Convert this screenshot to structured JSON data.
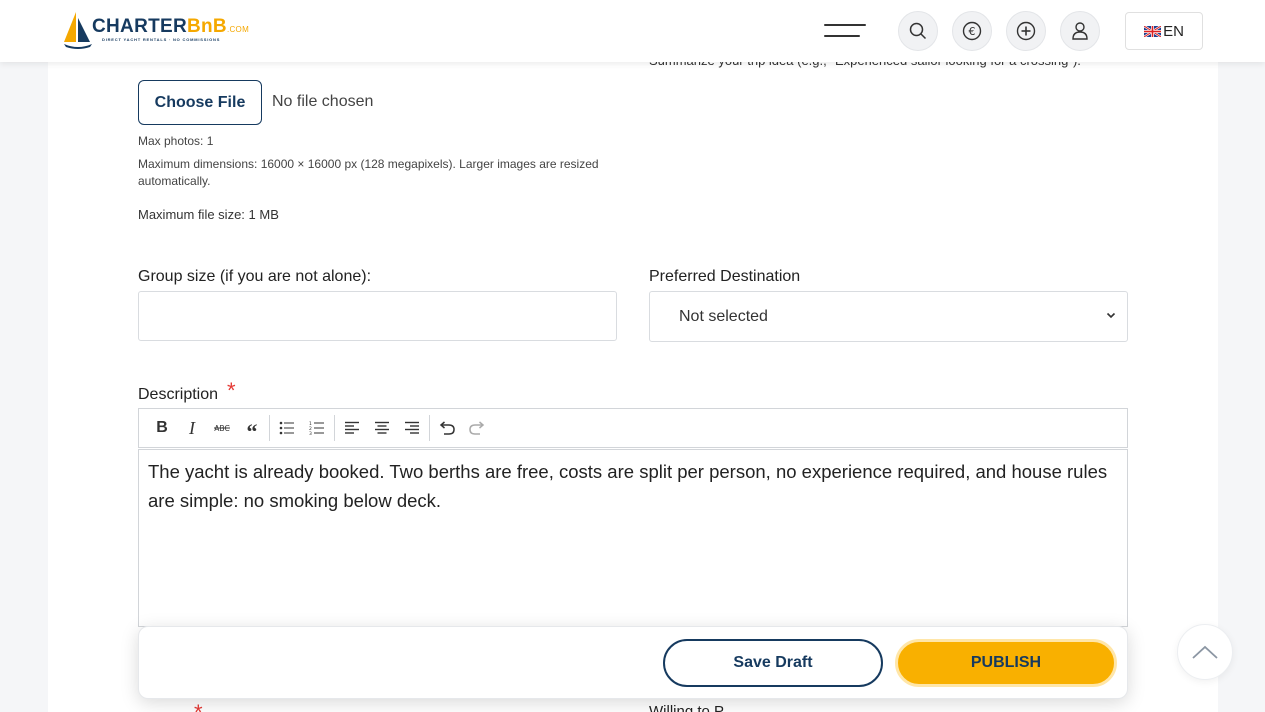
{
  "header": {
    "brand_main": "CHARTER",
    "brand_accent": "BnB",
    "brand_suffix": ".COM",
    "brand_tagline": "DIRECT YACHT RENTALS · NO COMMISSIONS",
    "language": "EN",
    "icons": [
      "menu-icon",
      "search-icon",
      "euro-icon",
      "plus-circle-icon",
      "user-icon",
      "uk-flag-icon"
    ]
  },
  "form": {
    "trip_summary_hint": "Summarize your trip idea (e.g., \"Experienced sailor looking for a crossing\").",
    "upload": {
      "button_label": "Choose File",
      "status": "No file chosen",
      "max_photos": "Max photos: 1",
      "max_dimensions": "Maximum dimensions: 16000 × 16000 px (128 megapixels). Larger images are resized automatically.",
      "max_size": "Maximum file size: 1 MB"
    },
    "group_size": {
      "label": "Group size (if you are not alone):",
      "value": ""
    },
    "destination": {
      "label": "Preferred Destination",
      "selected": "Not selected"
    },
    "description": {
      "label": "Description",
      "required_mark": "*",
      "toolbar": [
        "bold",
        "italic",
        "strikethrough",
        "blockquote",
        "bullet-list",
        "numbered-list",
        "align-left",
        "align-center",
        "align-right",
        "undo",
        "redo"
      ],
      "content": "The yacht is already booked. Two berths are free, costs are split per person, no experience required, and house rules are simple: no smoking below deck."
    },
    "next_field_label_partial": "Willing to P"
  },
  "actions": {
    "save_draft": "Save Draft",
    "publish": "PUBLISH"
  },
  "colors": {
    "brand_navy": "#163a5f",
    "brand_yellow": "#f9b000",
    "required": "#e53935"
  }
}
